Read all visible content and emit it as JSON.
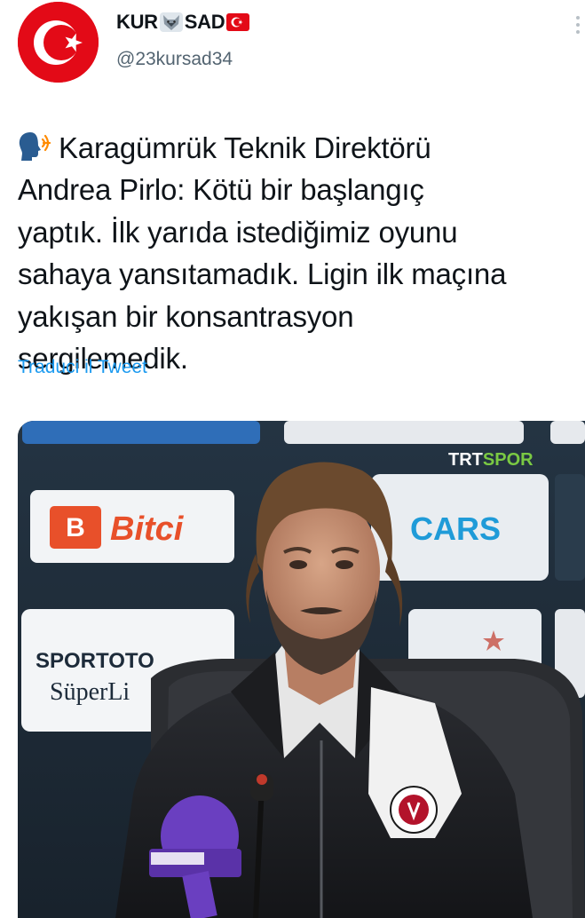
{
  "account": {
    "display_name_part1": "KUR",
    "display_name_part2": "SAD",
    "handle": "@23kursad34",
    "avatar_icon": "turkish-flag-icon",
    "name_emojis": [
      "wolf-icon",
      "turkish-flag-icon"
    ]
  },
  "tweet": {
    "emoji_icon": "speaking-head-icon",
    "text": "Karagümrük Teknik Direktörü\nAndrea Pirlo: Kötü bir başlangıç\nyaptık. İlk yarıda istediğimiz oyunu\nsahaya yansıtamadık. Ligin ilk maçına\nyakışan bir konsantrasyon\nsergilemedik.",
    "translate_label": "Traduci il Tweet"
  },
  "media": {
    "broadcaster_part1": "TRT",
    "broadcaster_part2": "SPOR",
    "sponsor_bitci": "Bitci",
    "sponsor_cars": "CARS",
    "sponsor_sportoto": "SPORTOTO",
    "sponsor_superlig": "SüperLi",
    "colors": {
      "flag_red": "#e30a17",
      "trt_green": "#7ac943",
      "mic_purple": "#6a3fc0"
    }
  }
}
